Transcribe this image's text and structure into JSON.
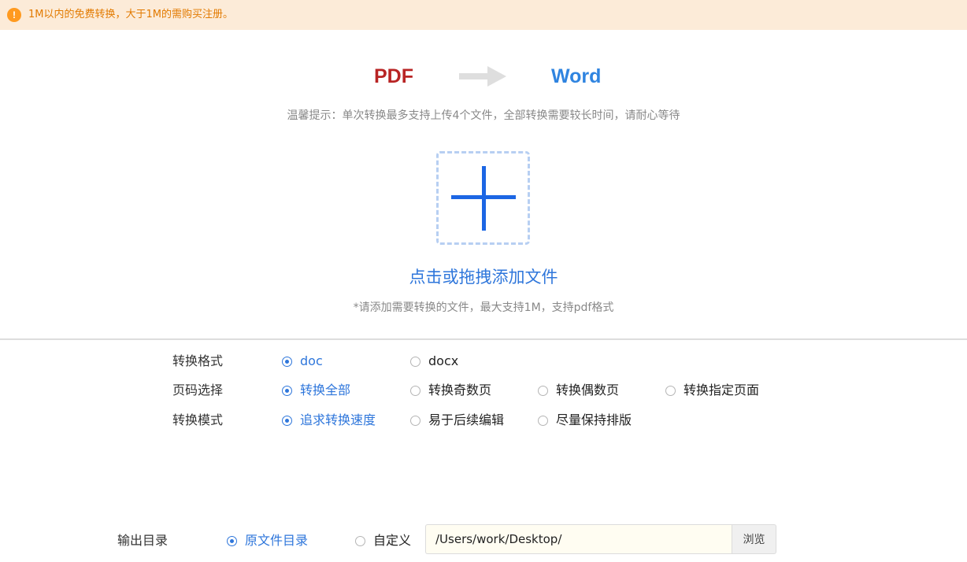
{
  "notice": {
    "icon": "exclamation-icon",
    "icon_glyph": "!",
    "text": "1M以内的免费转换，大于1M的需购买注册。"
  },
  "conversion": {
    "from": "PDF",
    "to": "Word",
    "arrow_icon": "right-arrow-icon"
  },
  "tip": "温馨提示：单次转换最多支持上传4个文件，全部转换需要较长时间，请耐心等待",
  "upload": {
    "icon": "plus-icon",
    "action_text": "点击或拖拽添加文件",
    "limit_text": "*请添加需要转换的文件，最大支持1M，支持pdf格式"
  },
  "options": {
    "format": {
      "label": "转换格式",
      "choices": [
        "doc",
        "docx"
      ],
      "selected": "doc"
    },
    "pages": {
      "label": "页码选择",
      "choices": [
        "转换全部",
        "转换奇数页",
        "转换偶数页",
        "转换指定页面"
      ],
      "selected": "转换全部"
    },
    "mode": {
      "label": "转换模式",
      "choices": [
        "追求转换速度",
        "易于后续编辑",
        "尽量保持排版"
      ],
      "selected": "追求转换速度"
    }
  },
  "output": {
    "label": "输出目录",
    "choices": [
      "原文件目录",
      "自定义"
    ],
    "selected": "原文件目录",
    "path_value": "/Users/work/Desktop/",
    "browse_label": "浏览"
  },
  "colors": {
    "accent_blue": "#2e76db",
    "pdf_red": "#b82424",
    "word_blue": "#2f84e0",
    "notice_bg": "#fcebd8",
    "notice_text": "#e27a00"
  }
}
